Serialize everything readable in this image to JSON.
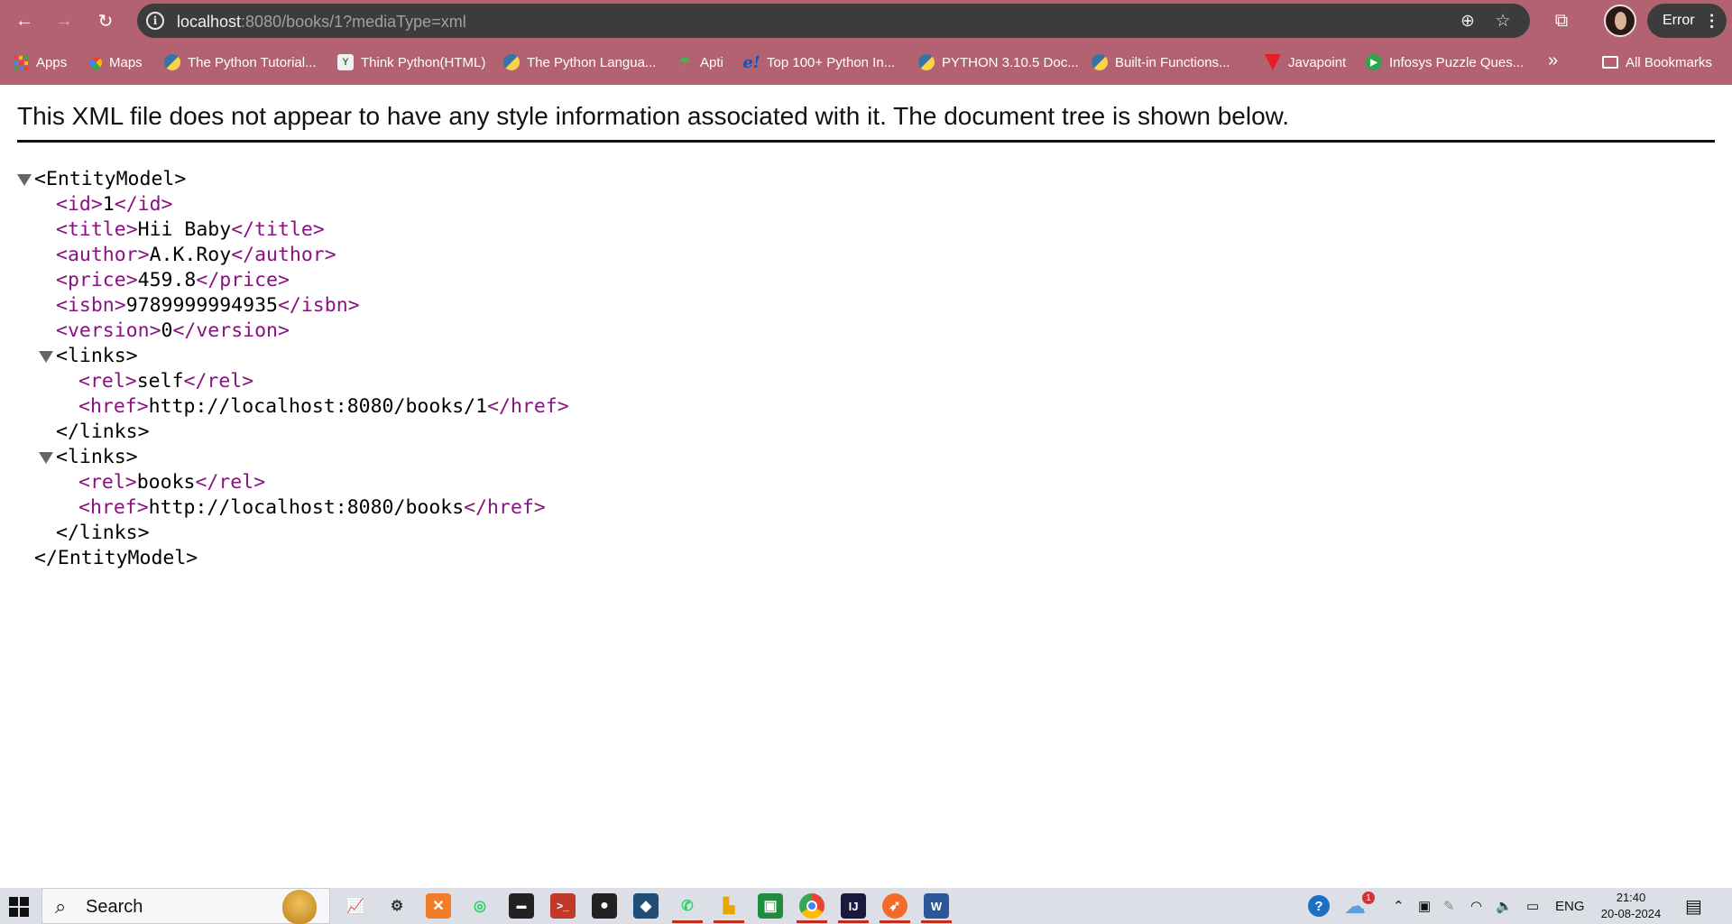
{
  "browser": {
    "url_host": "localhost",
    "url_rest": ":8080/books/1?mediaType=xml",
    "profile_status": "Error",
    "nav": {
      "back_icon": "arrow-left-icon",
      "forward_icon": "arrow-right-icon",
      "reload_icon": "reload-icon"
    },
    "bookmarks": [
      {
        "label": "Apps",
        "icon": "apps-grid-icon"
      },
      {
        "label": "Maps",
        "icon": "maps-icon"
      },
      {
        "label": "The Python Tutorial...",
        "icon": "python-icon"
      },
      {
        "label": "Think Python(HTML)",
        "icon": "think-python-icon"
      },
      {
        "label": "The Python Langua...",
        "icon": "python-icon"
      },
      {
        "label": "Apti",
        "icon": "apti-icon"
      },
      {
        "label": "Top 100+ Python In...",
        "icon": "edureka-icon"
      },
      {
        "label": "PYTHON 3.10.5 Doc...",
        "icon": "python-icon"
      },
      {
        "label": "Built-in Functions...",
        "icon": "python-icon"
      },
      {
        "label": "Javapoint",
        "icon": "javatpoint-icon"
      },
      {
        "label": "Infosys Puzzle Ques...",
        "icon": "infosys-icon"
      }
    ],
    "bookmarks_more": "»",
    "all_bookmarks": "All Bookmarks"
  },
  "page": {
    "heading": "This XML file does not appear to have any style information associated with it. The document tree is shown below.",
    "xml": {
      "root_open": "<EntityModel>",
      "root_close": "</EntityModel>",
      "fields": [
        {
          "tag": "id",
          "value": "1"
        },
        {
          "tag": "title",
          "value": "Hii Baby"
        },
        {
          "tag": "author",
          "value": "A.K.Roy"
        },
        {
          "tag": "price",
          "value": "459.8"
        },
        {
          "tag": "isbn",
          "value": "9789999994935"
        },
        {
          "tag": "version",
          "value": "0"
        }
      ],
      "links": [
        {
          "rel": "self",
          "href": "http://localhost:8080/books/1"
        },
        {
          "rel": "books",
          "href": "http://localhost:8080/books"
        }
      ]
    }
  },
  "taskbar": {
    "search_label": "Search",
    "language": "ENG",
    "time": "21:40",
    "date": "20-08-2024",
    "weather_badge": "1",
    "help_icon": "help-icon"
  }
}
